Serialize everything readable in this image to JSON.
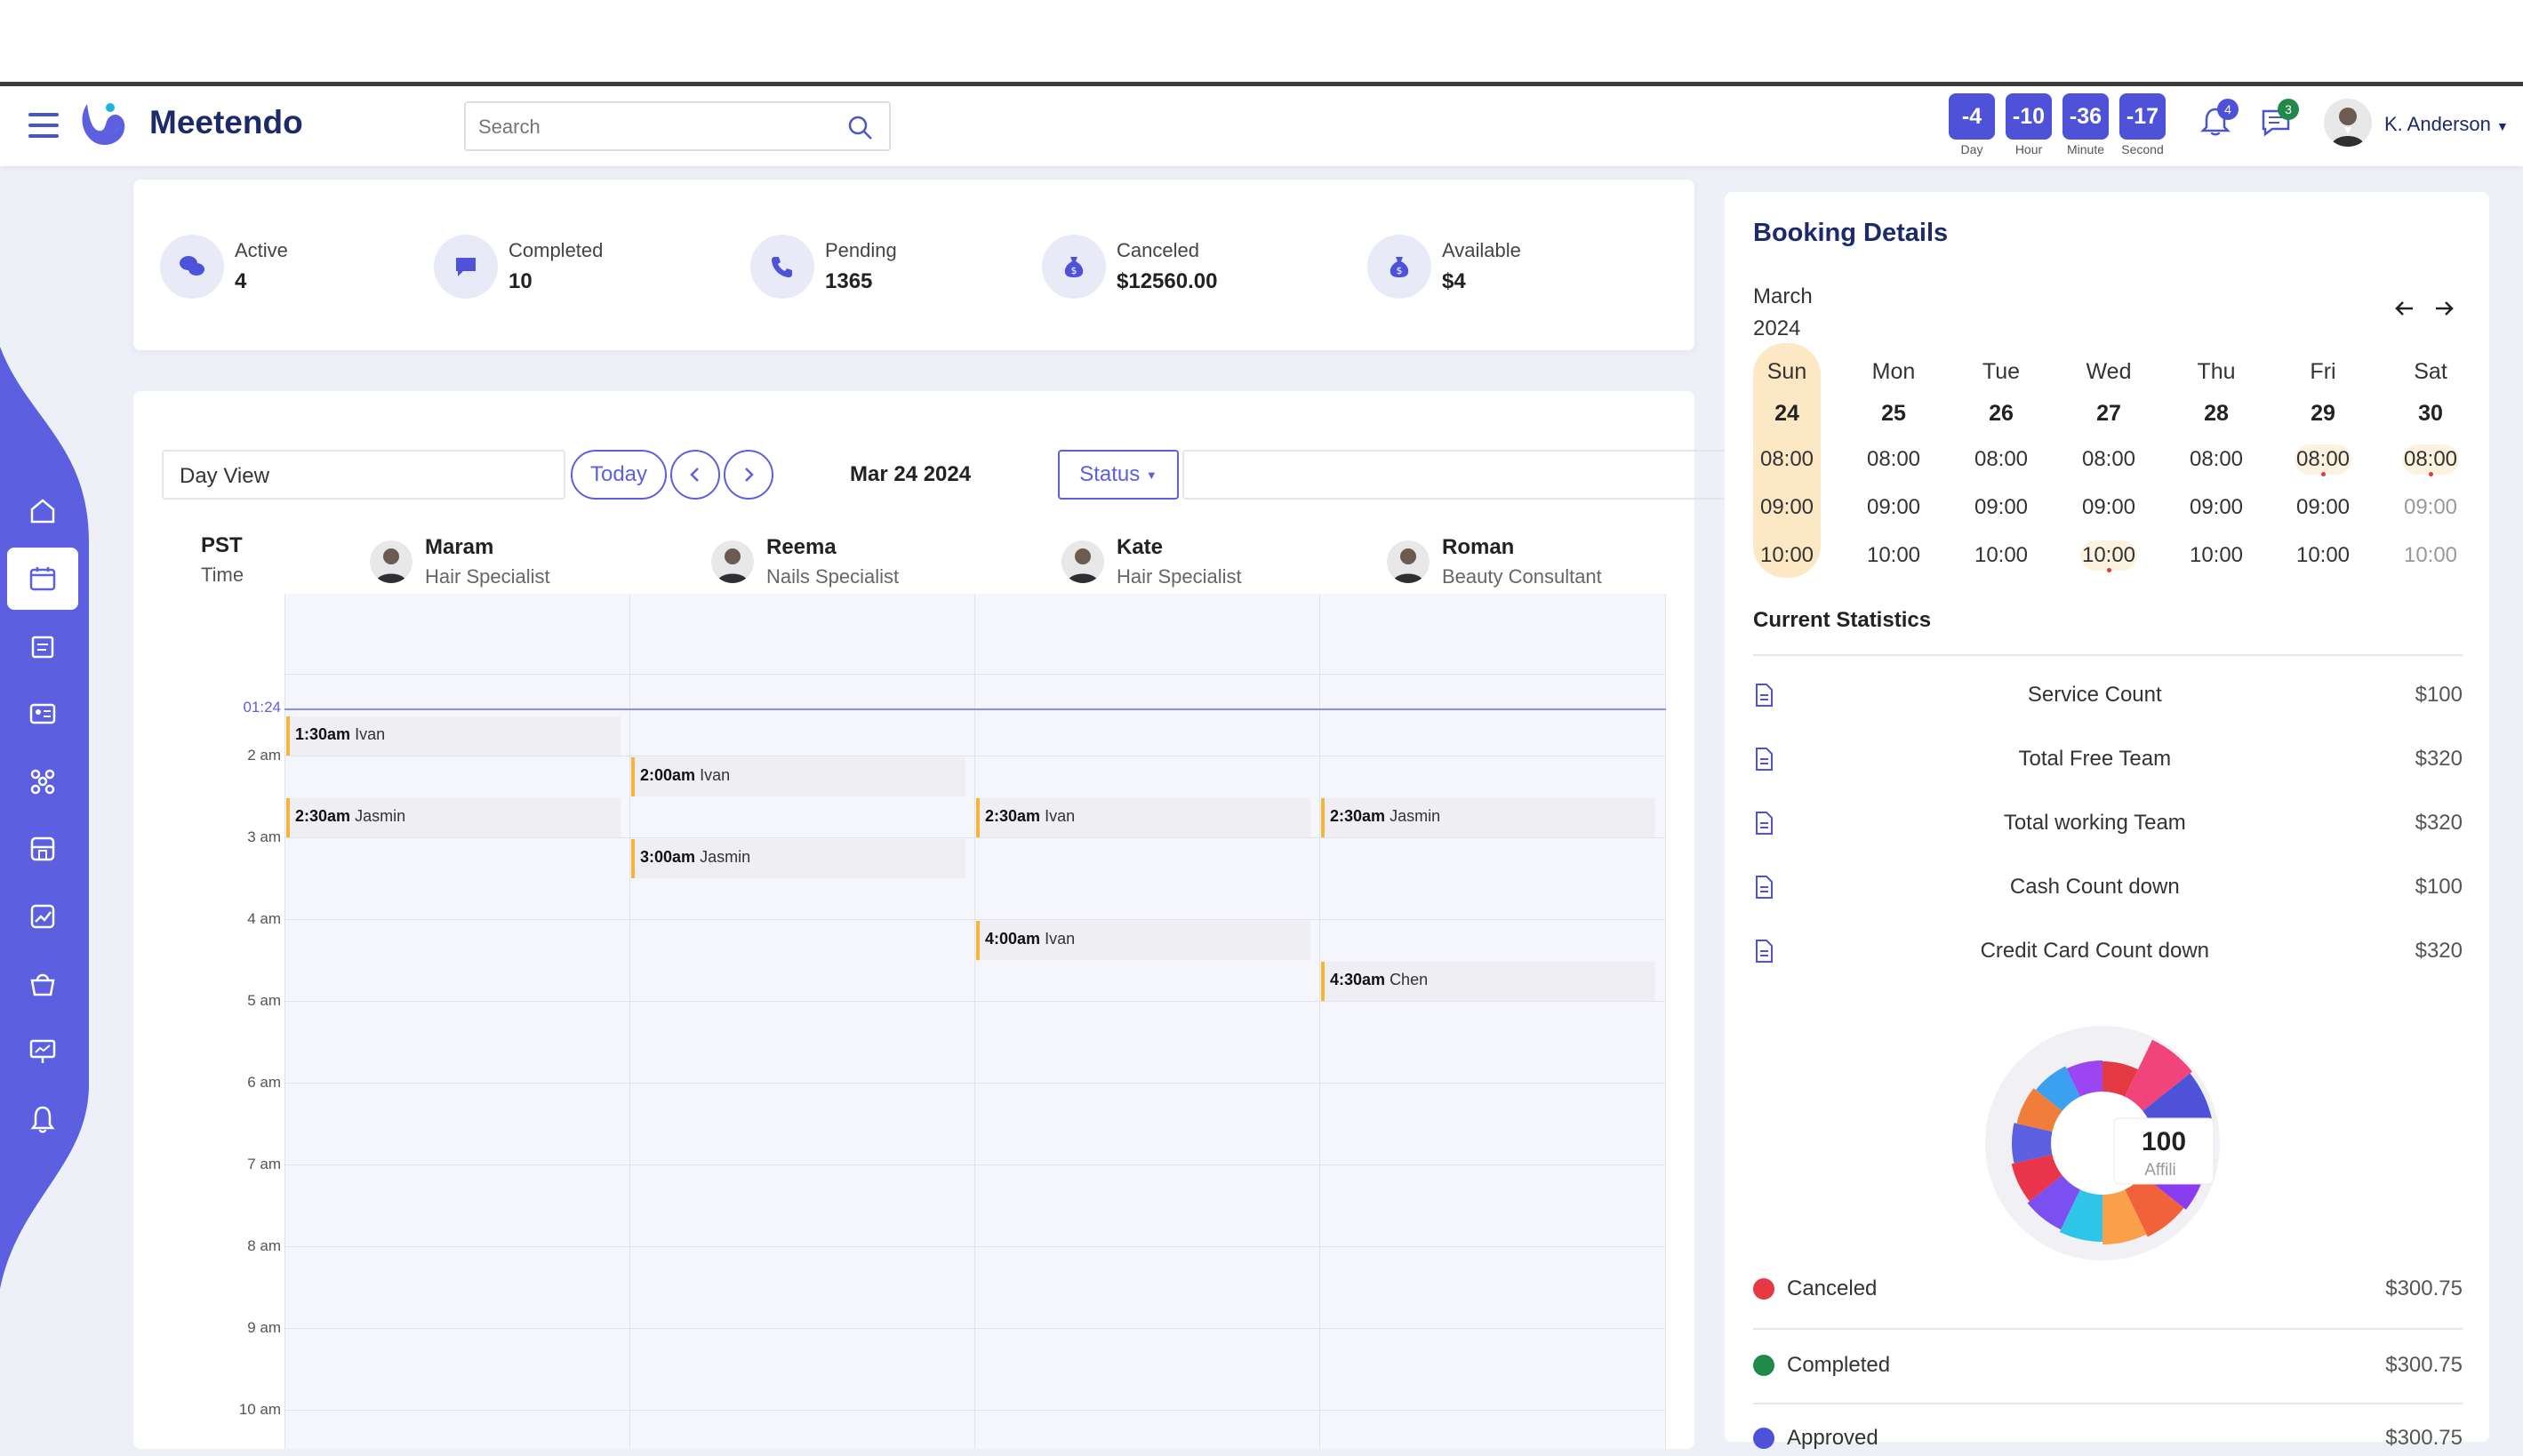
{
  "app": {
    "brand": "Meetendo"
  },
  "search": {
    "placeholder": "Search"
  },
  "countdown": [
    {
      "value": "-4",
      "label": "Day"
    },
    {
      "value": "-10",
      "label": "Hour"
    },
    {
      "value": "-36",
      "label": "Minute"
    },
    {
      "value": "-17",
      "label": "Second"
    }
  ],
  "notifications": {
    "bell_count": "4",
    "message_count": "3"
  },
  "user": {
    "name": "K. Anderson"
  },
  "colors": {
    "accent": "#5b5fe0",
    "sidebar": "#5b5fe0",
    "brand_text": "#1c2a6b",
    "appt_bar": "#f5b43a"
  },
  "sidebar": {
    "items": [
      {
        "icon": "home-icon"
      },
      {
        "icon": "calendar-icon",
        "active": true
      },
      {
        "icon": "notebook-icon"
      },
      {
        "icon": "contact-card-icon"
      },
      {
        "icon": "network-icon"
      },
      {
        "icon": "store-icon"
      },
      {
        "icon": "analytics-icon"
      },
      {
        "icon": "basket-icon"
      },
      {
        "icon": "presentation-icon"
      },
      {
        "icon": "bell-icon"
      }
    ]
  },
  "stats": [
    {
      "label": "Active",
      "value": "4",
      "icon": "chat-bubbles-icon"
    },
    {
      "label": "Completed",
      "value": "10",
      "icon": "message-icon"
    },
    {
      "label": "Pending",
      "value": "1365",
      "icon": "phone-icon"
    },
    {
      "label": "Canceled",
      "value": "$12560.00",
      "icon": "money-bag-icon"
    },
    {
      "label": "Available",
      "value": "$4",
      "icon": "money-bag-icon"
    }
  ],
  "calendar": {
    "view": "Day View",
    "today_label": "Today",
    "date": "Mar 24 2024",
    "status_label": "Status",
    "timezone": "PST",
    "time_label": "Time",
    "now_label": "01:24",
    "staff": [
      {
        "name": "Maram",
        "role": "Hair Specialist"
      },
      {
        "name": "Reema",
        "role": "Nails Specialist"
      },
      {
        "name": "Kate",
        "role": "Hair Specialist"
      },
      {
        "name": "Roman",
        "role": "Beauty Consultant"
      }
    ],
    "hours": [
      "2 am",
      "3 am",
      "4 am",
      "5 am",
      "6 am",
      "7 am",
      "8 am",
      "9 am",
      "10 am"
    ],
    "appointments": [
      {
        "time": "1:30am",
        "client": "Ivan",
        "staff": 0
      },
      {
        "time": "2:00am",
        "client": "Ivan",
        "staff": 1
      },
      {
        "time": "2:30am",
        "client": "Jasmin",
        "staff": 0
      },
      {
        "time": "2:30am",
        "client": "Ivan",
        "staff": 2
      },
      {
        "time": "2:30am",
        "client": "Jasmin",
        "staff": 3
      },
      {
        "time": "3:00am",
        "client": "Jasmin",
        "staff": 1
      },
      {
        "time": "4:00am",
        "client": "Ivan",
        "staff": 2
      },
      {
        "time": "4:30am",
        "client": "Chen",
        "staff": 3
      }
    ]
  },
  "booking": {
    "title": "Booking Details",
    "month": "March",
    "year": "2024",
    "days": [
      {
        "name": "Sun",
        "num": "24",
        "selected": true,
        "slots": [
          {
            "t": "08:00"
          },
          {
            "t": "09:00"
          },
          {
            "t": "10:00"
          }
        ]
      },
      {
        "name": "Mon",
        "num": "25",
        "slots": [
          {
            "t": "08:00"
          },
          {
            "t": "09:00"
          },
          {
            "t": "10:00"
          }
        ]
      },
      {
        "name": "Tue",
        "num": "26",
        "slots": [
          {
            "t": "08:00"
          },
          {
            "t": "09:00"
          },
          {
            "t": "10:00"
          }
        ]
      },
      {
        "name": "Wed",
        "num": "27",
        "slots": [
          {
            "t": "08:00"
          },
          {
            "t": "09:00"
          },
          {
            "t": "10:00",
            "marked": true
          }
        ]
      },
      {
        "name": "Thu",
        "num": "28",
        "slots": [
          {
            "t": "08:00"
          },
          {
            "t": "09:00"
          },
          {
            "t": "10:00"
          }
        ]
      },
      {
        "name": "Fri",
        "num": "29",
        "slots": [
          {
            "t": "08:00",
            "marked": true
          },
          {
            "t": "09:00"
          },
          {
            "t": "10:00"
          }
        ]
      },
      {
        "name": "Sat",
        "num": "30",
        "slots": [
          {
            "t": "08:00",
            "marked": true
          },
          {
            "t": "09:00",
            "off": true
          },
          {
            "t": "10:00",
            "off": true
          }
        ]
      }
    ],
    "stats_title": "Current Statistics",
    "stats": [
      {
        "label": "Service Count",
        "value": "$100"
      },
      {
        "label": "Total Free Team",
        "value": "$320"
      },
      {
        "label": "Total working Team",
        "value": "$320"
      },
      {
        "label": "Cash Count down",
        "value": "$100"
      },
      {
        "label": "Credit Card Count down",
        "value": "$320"
      }
    ],
    "donut": {
      "value": "100",
      "label": "Affili"
    },
    "legend": [
      {
        "label": "Canceled",
        "value": "$300.75",
        "color": "#e53944"
      },
      {
        "label": "Completed",
        "value": "$300.75",
        "color": "#22884b"
      },
      {
        "label": "Approved",
        "value": "$300.75",
        "color": "#4e52d8"
      }
    ]
  }
}
